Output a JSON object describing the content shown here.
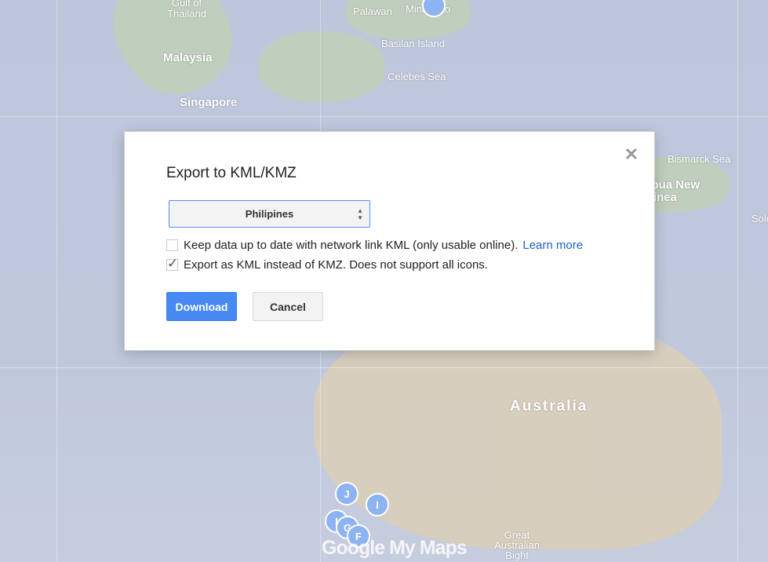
{
  "map": {
    "labels": [
      "Gulf of Thailand",
      "Palawan",
      "Mindanao",
      "Basilan Island",
      "Malaysia",
      "Celebes Sea",
      "Singapore",
      "Bismarck Sea",
      "Papua New Guinea",
      "Solomon",
      "Australia",
      "Great Australian Bight"
    ],
    "markers": [
      "J",
      "I",
      "I",
      "G",
      "F"
    ],
    "logo": "Google My Maps"
  },
  "dialog": {
    "title": "Export to KML/KMZ",
    "close_icon": "close-icon",
    "layer_select": {
      "value": "Philipines"
    },
    "options": [
      {
        "label": "Keep data up to date with network link KML (only usable online).",
        "checked": false,
        "link": "Learn more"
      },
      {
        "label": "Export as KML instead of KMZ. Does not support all icons.",
        "checked": true
      }
    ],
    "download_label": "Download",
    "cancel_label": "Cancel",
    "accent": "#4889f4"
  }
}
